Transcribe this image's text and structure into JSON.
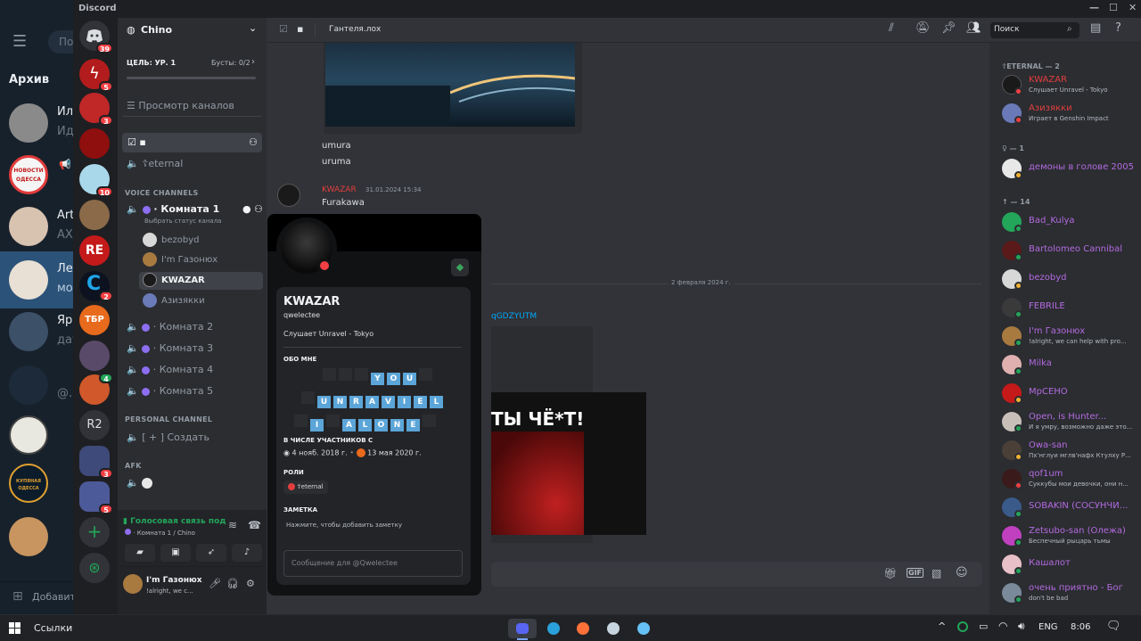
{
  "telegram": {
    "archive_label": "Архив",
    "search_placeholder": "По",
    "chats": [
      {
        "name": "Ил",
        "preview": "Ид"
      },
      {
        "name": "",
        "avatar_text": "НОВОСТИ ОДЕССА",
        "preview": ""
      },
      {
        "name": "Art",
        "preview": "АХ"
      },
      {
        "name": "Лет",
        "preview": "мо"
      },
      {
        "name": "Яр",
        "preview": "дау"
      },
      {
        "name": "",
        "preview": "@."
      },
      {
        "name": "",
        "preview": ""
      },
      {
        "name": "",
        "avatar_text": "КУПЯНАЯ ОДЕССА",
        "preview": ""
      },
      {
        "name": "",
        "preview": ""
      }
    ],
    "add_label": "Добавит"
  },
  "window": {
    "title": "Discord"
  },
  "servers": [
    {
      "name": "home",
      "badge": "39"
    },
    {
      "name": "s1",
      "badge": "5"
    },
    {
      "name": "s2",
      "badge": "3"
    },
    {
      "name": "s3",
      "badge": ""
    },
    {
      "name": "s4",
      "badge": "10"
    },
    {
      "name": "s5",
      "badge": ""
    },
    {
      "name": "s6",
      "text": "RE",
      "badge": ""
    },
    {
      "name": "s7",
      "badge": "2"
    },
    {
      "name": "s8",
      "text": "ТБР",
      "badge": ""
    },
    {
      "name": "s9",
      "badge": ""
    },
    {
      "name": "s10",
      "badge": "4"
    },
    {
      "name": "s11",
      "text": "R2",
      "badge": ""
    },
    {
      "name": "s12",
      "badge": "3"
    },
    {
      "name": "s13",
      "badge": "5"
    }
  ],
  "guild": {
    "name": "Chino",
    "goal_label": "ЦЕЛЬ: УР. 1",
    "boosts_label": "Бусты: 0/2",
    "browse_label": "Просмотр каналов",
    "text_channels": [
      {
        "name": ""
      },
      {
        "name": "☦eternal"
      }
    ],
    "voice_category": "VOICE CHANNELS",
    "voice_channels": [
      {
        "name": "Комната 1",
        "status": "Выбрать статус канала"
      },
      {
        "name": "Комната 2"
      },
      {
        "name": "Комната 3"
      },
      {
        "name": "Комната 4"
      },
      {
        "name": "Комната 5"
      }
    ],
    "voice_users": [
      "bezobyd",
      "I'm Газонюх",
      "KWAZAR",
      "Азизякки"
    ],
    "personal_category": "PERSONAL CHANNEL",
    "personal_channel": "[ + ] Создать",
    "afk_category": "AFK"
  },
  "voice_panel": {
    "status": "Голосовая связь под",
    "location": "Комната 1 / Chino"
  },
  "user_panel": {
    "name": "I'm Газонюх",
    "status": "!alright, we c..."
  },
  "chat": {
    "channel_name": "Гантеля.лох",
    "lines": [
      "umura",
      "uruma"
    ],
    "message": {
      "author": "KWAZAR",
      "time": "31.01.2024 15:34",
      "text": "Furakawa"
    },
    "date_divider": "2 февраля 2024 г.",
    "link_fragment": "qGDZYUTM",
    "image_text": "ТЫ ЧЁ*Т!"
  },
  "header": {
    "search_placeholder": "Поиск"
  },
  "popout": {
    "display_name": "KWAZAR",
    "username": "qwelectee",
    "activity": "Слушает Unravel - Tokyo",
    "about_title": "ОБО МНЕ",
    "about_rows": [
      {
        "tiles": [
          "Y",
          "O",
          "U"
        ],
        "lead": 3,
        "trail": 1
      },
      {
        "tiles": [
          "U",
          "N",
          "R",
          "A",
          "V",
          "I",
          "E",
          "L"
        ],
        "lead": 1,
        "trail": 0
      },
      {
        "tiles": [
          "I",
          "",
          "A",
          "L",
          "O",
          "N",
          "E"
        ],
        "lead": 1,
        "trail": 1
      }
    ],
    "member_since_title": "В ЧИСЛЕ УЧАСТНИКОВ С",
    "discord_since": "4 нояб. 2018 г.",
    "server_since": "13 мая 2020 г.",
    "roles_title": "РОЛИ",
    "role": "☦eternal",
    "note_title": "ЗАМЕТКА",
    "note_placeholder": "Нажмите, чтобы добавить заметку",
    "message_placeholder": "Сообщение для @Qwelectee"
  },
  "members": {
    "groups": [
      {
        "title": "☦ETERNAL — 2",
        "items": [
          {
            "name": "KWAZAR",
            "sub": "Слушает Unravel - Tokyo",
            "color": "#e33e3e",
            "status": "dnd"
          },
          {
            "name": "Азизякки",
            "sub": "Играет в Genshin Impact",
            "color": "#e33e3e",
            "status": "dnd"
          }
        ]
      },
      {
        "title": "♀ — 1",
        "items": [
          {
            "name": "демоны в голове 2005",
            "sub": "",
            "color": "#b46ae0",
            "status": "idle"
          }
        ]
      },
      {
        "title": "↑ — 14",
        "items": [
          {
            "name": "Bad_Kulya",
            "sub": "",
            "color": "#b46ae0",
            "status": "online"
          },
          {
            "name": "Bartolomeo Cannibal",
            "sub": "",
            "color": "#b46ae0",
            "status": "online"
          },
          {
            "name": "bezobyd",
            "sub": "",
            "color": "#b46ae0",
            "status": "idle"
          },
          {
            "name": "FEBRILE",
            "sub": "",
            "color": "#b46ae0",
            "status": "online"
          },
          {
            "name": "I'm Газонюх",
            "sub": "!alright, we can help with pro...",
            "color": "#b46ae0",
            "status": "online"
          },
          {
            "name": "Milka",
            "sub": "",
            "color": "#b46ae0",
            "status": "online"
          },
          {
            "name": "МрСЕНО",
            "sub": "",
            "color": "#b46ae0",
            "status": "idle"
          },
          {
            "name": "Open, is Hunter...",
            "sub": "И я умру, возможно даже это...",
            "color": "#b46ae0",
            "status": "online"
          },
          {
            "name": "Owa-san",
            "sub": "Пх'нглуи мглв'нафх Ктулху Р...",
            "color": "#b46ae0",
            "status": "idle"
          },
          {
            "name": "qof1um",
            "sub": "Суккубы мои девочки, они н...",
            "color": "#b46ae0",
            "status": "dnd"
          },
          {
            "name": "SOBAKIN (СОСУНЧИ...",
            "sub": "",
            "color": "#b46ae0",
            "status": "online"
          },
          {
            "name": "Zetsubo-san (Олежа)",
            "sub": "Беспечный рыцарь тьмы",
            "color": "#b46ae0",
            "status": "online"
          },
          {
            "name": "Кашалот",
            "sub": "",
            "color": "#b46ae0",
            "status": "online"
          },
          {
            "name": "очень приятно - Бог",
            "sub": "don't be bad",
            "color": "#b46ae0",
            "status": "online"
          }
        ]
      }
    ]
  },
  "taskbar": {
    "search_label": "Ссылки",
    "language": "ENG",
    "time": "8:06"
  },
  "colors": {
    "accent": "#5865f2",
    "voice_green": "#23a55a",
    "dnd": "#f23f43",
    "idle": "#f0b232",
    "online": "#23a55a",
    "member_purple": "#b46ae0",
    "kwazar_red": "#e33e3e"
  }
}
